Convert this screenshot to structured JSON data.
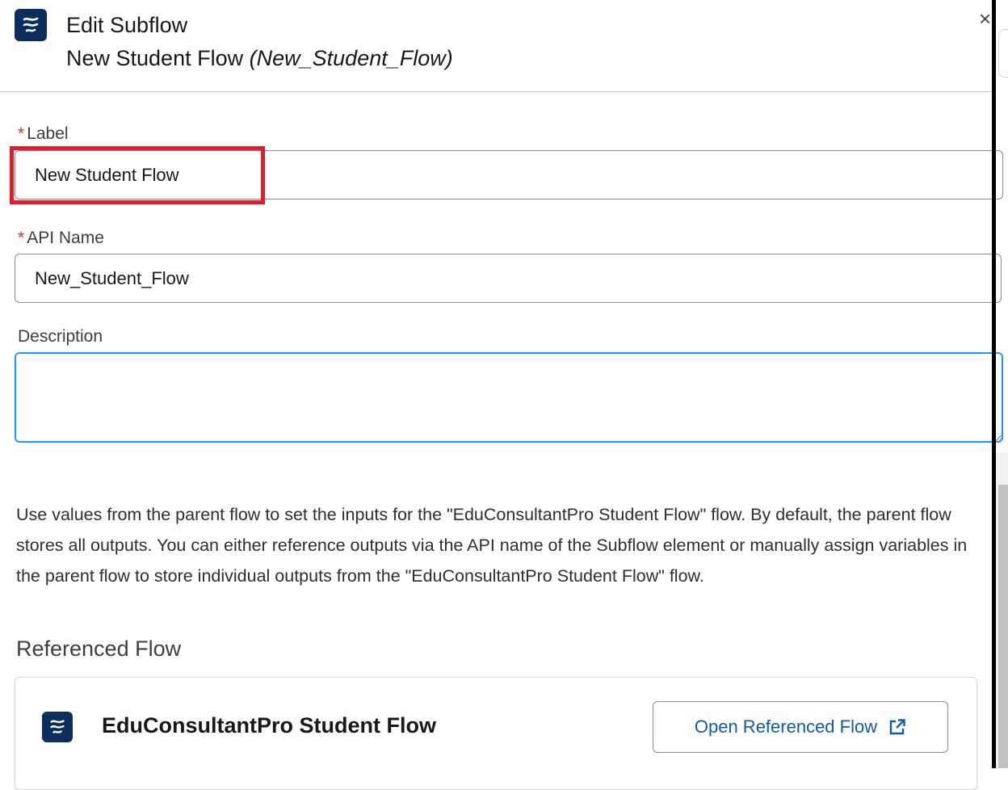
{
  "header": {
    "title": "Edit Subflow",
    "subtitle_label": "New Student Flow",
    "subtitle_api": "(New_Student_Flow)",
    "close_glyph": "×",
    "icon": "flow-icon"
  },
  "form": {
    "required_mark": "*",
    "label": {
      "label": "Label",
      "value": "New Student Flow"
    },
    "api_name": {
      "label": "API Name",
      "value": "New_Student_Flow"
    },
    "description": {
      "label": "Description",
      "value": ""
    }
  },
  "info_text": "Use values from the parent flow to set the inputs for the \"EduConsultantPro Student Flow\" flow. By default, the parent flow stores all outputs. You can either reference outputs via the API name of the Subflow element or manually assign variables in the parent flow to store individual outputs from the \"EduConsultantPro Student Flow\" flow.",
  "referenced_flow": {
    "heading": "Referenced Flow",
    "name": "EduConsultantPro Student Flow",
    "open_button": "Open Referenced Flow",
    "icon": "flow-icon",
    "button_icon": "external-link-icon"
  },
  "colors": {
    "brand_navy": "#0b2e5e",
    "link_blue": "#0b5cab",
    "focus_blue": "#1b96ff",
    "required_red": "#c23934",
    "highlight_red": "#e11d2a"
  }
}
